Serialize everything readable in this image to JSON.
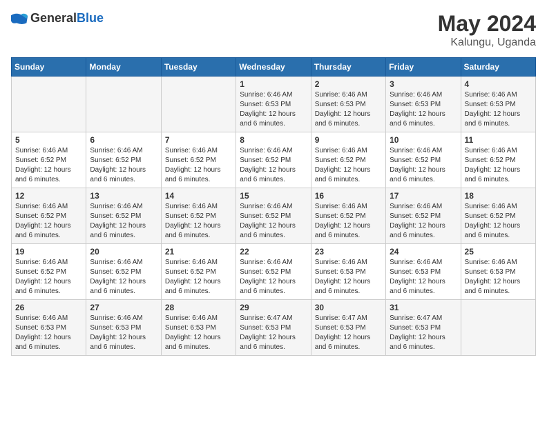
{
  "logo": {
    "general": "General",
    "blue": "Blue"
  },
  "title": {
    "month_year": "May 2024",
    "location": "Kalungu, Uganda"
  },
  "weekdays": [
    "Sunday",
    "Monday",
    "Tuesday",
    "Wednesday",
    "Thursday",
    "Friday",
    "Saturday"
  ],
  "weeks": [
    [
      {
        "day": "",
        "sunrise": "",
        "sunset": "",
        "daylight": ""
      },
      {
        "day": "",
        "sunrise": "",
        "sunset": "",
        "daylight": ""
      },
      {
        "day": "",
        "sunrise": "",
        "sunset": "",
        "daylight": ""
      },
      {
        "day": "1",
        "sunrise": "Sunrise: 6:46 AM",
        "sunset": "Sunset: 6:53 PM",
        "daylight": "Daylight: 12 hours and 6 minutes."
      },
      {
        "day": "2",
        "sunrise": "Sunrise: 6:46 AM",
        "sunset": "Sunset: 6:53 PM",
        "daylight": "Daylight: 12 hours and 6 minutes."
      },
      {
        "day": "3",
        "sunrise": "Sunrise: 6:46 AM",
        "sunset": "Sunset: 6:53 PM",
        "daylight": "Daylight: 12 hours and 6 minutes."
      },
      {
        "day": "4",
        "sunrise": "Sunrise: 6:46 AM",
        "sunset": "Sunset: 6:53 PM",
        "daylight": "Daylight: 12 hours and 6 minutes."
      }
    ],
    [
      {
        "day": "5",
        "sunrise": "Sunrise: 6:46 AM",
        "sunset": "Sunset: 6:52 PM",
        "daylight": "Daylight: 12 hours and 6 minutes."
      },
      {
        "day": "6",
        "sunrise": "Sunrise: 6:46 AM",
        "sunset": "Sunset: 6:52 PM",
        "daylight": "Daylight: 12 hours and 6 minutes."
      },
      {
        "day": "7",
        "sunrise": "Sunrise: 6:46 AM",
        "sunset": "Sunset: 6:52 PM",
        "daylight": "Daylight: 12 hours and 6 minutes."
      },
      {
        "day": "8",
        "sunrise": "Sunrise: 6:46 AM",
        "sunset": "Sunset: 6:52 PM",
        "daylight": "Daylight: 12 hours and 6 minutes."
      },
      {
        "day": "9",
        "sunrise": "Sunrise: 6:46 AM",
        "sunset": "Sunset: 6:52 PM",
        "daylight": "Daylight: 12 hours and 6 minutes."
      },
      {
        "day": "10",
        "sunrise": "Sunrise: 6:46 AM",
        "sunset": "Sunset: 6:52 PM",
        "daylight": "Daylight: 12 hours and 6 minutes."
      },
      {
        "day": "11",
        "sunrise": "Sunrise: 6:46 AM",
        "sunset": "Sunset: 6:52 PM",
        "daylight": "Daylight: 12 hours and 6 minutes."
      }
    ],
    [
      {
        "day": "12",
        "sunrise": "Sunrise: 6:46 AM",
        "sunset": "Sunset: 6:52 PM",
        "daylight": "Daylight: 12 hours and 6 minutes."
      },
      {
        "day": "13",
        "sunrise": "Sunrise: 6:46 AM",
        "sunset": "Sunset: 6:52 PM",
        "daylight": "Daylight: 12 hours and 6 minutes."
      },
      {
        "day": "14",
        "sunrise": "Sunrise: 6:46 AM",
        "sunset": "Sunset: 6:52 PM",
        "daylight": "Daylight: 12 hours and 6 minutes."
      },
      {
        "day": "15",
        "sunrise": "Sunrise: 6:46 AM",
        "sunset": "Sunset: 6:52 PM",
        "daylight": "Daylight: 12 hours and 6 minutes."
      },
      {
        "day": "16",
        "sunrise": "Sunrise: 6:46 AM",
        "sunset": "Sunset: 6:52 PM",
        "daylight": "Daylight: 12 hours and 6 minutes."
      },
      {
        "day": "17",
        "sunrise": "Sunrise: 6:46 AM",
        "sunset": "Sunset: 6:52 PM",
        "daylight": "Daylight: 12 hours and 6 minutes."
      },
      {
        "day": "18",
        "sunrise": "Sunrise: 6:46 AM",
        "sunset": "Sunset: 6:52 PM",
        "daylight": "Daylight: 12 hours and 6 minutes."
      }
    ],
    [
      {
        "day": "19",
        "sunrise": "Sunrise: 6:46 AM",
        "sunset": "Sunset: 6:52 PM",
        "daylight": "Daylight: 12 hours and 6 minutes."
      },
      {
        "day": "20",
        "sunrise": "Sunrise: 6:46 AM",
        "sunset": "Sunset: 6:52 PM",
        "daylight": "Daylight: 12 hours and 6 minutes."
      },
      {
        "day": "21",
        "sunrise": "Sunrise: 6:46 AM",
        "sunset": "Sunset: 6:52 PM",
        "daylight": "Daylight: 12 hours and 6 minutes."
      },
      {
        "day": "22",
        "sunrise": "Sunrise: 6:46 AM",
        "sunset": "Sunset: 6:52 PM",
        "daylight": "Daylight: 12 hours and 6 minutes."
      },
      {
        "day": "23",
        "sunrise": "Sunrise: 6:46 AM",
        "sunset": "Sunset: 6:53 PM",
        "daylight": "Daylight: 12 hours and 6 minutes."
      },
      {
        "day": "24",
        "sunrise": "Sunrise: 6:46 AM",
        "sunset": "Sunset: 6:53 PM",
        "daylight": "Daylight: 12 hours and 6 minutes."
      },
      {
        "day": "25",
        "sunrise": "Sunrise: 6:46 AM",
        "sunset": "Sunset: 6:53 PM",
        "daylight": "Daylight: 12 hours and 6 minutes."
      }
    ],
    [
      {
        "day": "26",
        "sunrise": "Sunrise: 6:46 AM",
        "sunset": "Sunset: 6:53 PM",
        "daylight": "Daylight: 12 hours and 6 minutes."
      },
      {
        "day": "27",
        "sunrise": "Sunrise: 6:46 AM",
        "sunset": "Sunset: 6:53 PM",
        "daylight": "Daylight: 12 hours and 6 minutes."
      },
      {
        "day": "28",
        "sunrise": "Sunrise: 6:46 AM",
        "sunset": "Sunset: 6:53 PM",
        "daylight": "Daylight: 12 hours and 6 minutes."
      },
      {
        "day": "29",
        "sunrise": "Sunrise: 6:47 AM",
        "sunset": "Sunset: 6:53 PM",
        "daylight": "Daylight: 12 hours and 6 minutes."
      },
      {
        "day": "30",
        "sunrise": "Sunrise: 6:47 AM",
        "sunset": "Sunset: 6:53 PM",
        "daylight": "Daylight: 12 hours and 6 minutes."
      },
      {
        "day": "31",
        "sunrise": "Sunrise: 6:47 AM",
        "sunset": "Sunset: 6:53 PM",
        "daylight": "Daylight: 12 hours and 6 minutes."
      },
      {
        "day": "",
        "sunrise": "",
        "sunset": "",
        "daylight": ""
      }
    ]
  ]
}
